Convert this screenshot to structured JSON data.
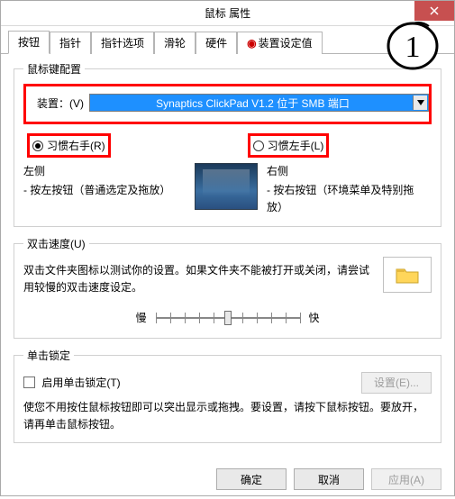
{
  "window": {
    "title": "鼠标 属性"
  },
  "tabs": [
    "按钮",
    "指针",
    "指针选项",
    "滑轮",
    "硬件",
    "装置设定值"
  ],
  "active_tab_index": 0,
  "sections": {
    "mouse_config_legend": "鼠标键配置",
    "device_label": "装置：(V)",
    "device_value": "Synaptics ClickPad V1.2 位于 SMB 端口",
    "right_hand": "习惯右手(R)",
    "left_hand": "习惯左手(L)",
    "left_col_title": "左侧",
    "left_col_desc": "- 按左按钮（普通选定及拖放）",
    "right_col_title": "右侧",
    "right_col_desc": "- 按右按钮（环境菜单及特别拖放）",
    "double_click_legend": "双击速度(U)",
    "double_click_desc": "双击文件夹图标以测试你的设置。如果文件夹不能被打开或关闭，请尝试用较慢的双击速度设定。",
    "slow": "慢",
    "fast": "快",
    "click_lock_legend": "单击锁定",
    "enable_lock": "启用单击锁定(T)",
    "settings_btn": "设置(E)...",
    "lock_desc": "使您不用按住鼠标按钮即可以突出显示或拖拽。要设置，请按下鼠标按钮。要放开，请再单击鼠标按钮。"
  },
  "footer": {
    "ok": "确定",
    "cancel": "取消",
    "apply": "应用(A)"
  },
  "annotation": {
    "number": "1"
  },
  "icons": {
    "close": "close-icon",
    "tab_device": "device-tab-icon",
    "folder": "folder-icon",
    "dropdown": "chevron-down-icon"
  }
}
